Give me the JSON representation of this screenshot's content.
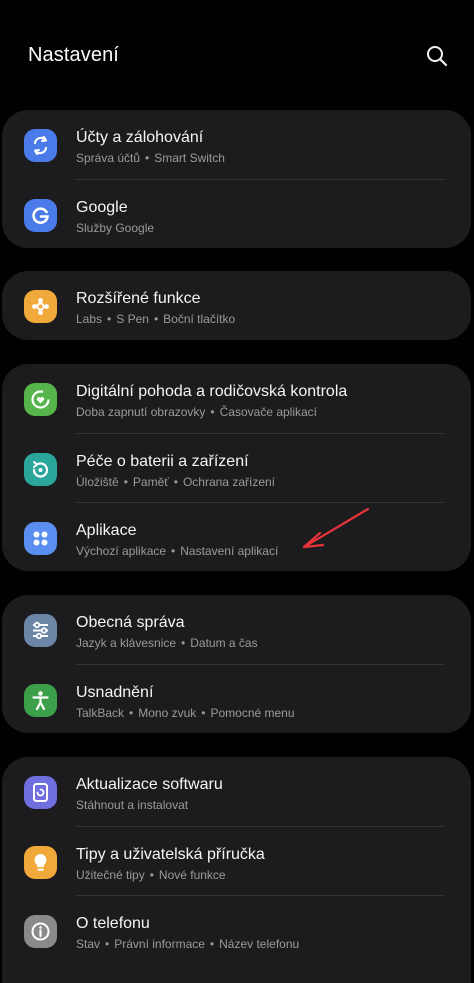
{
  "header": {
    "title": "Nastavení"
  },
  "cards": [
    {
      "rows": [
        {
          "label": "Účty a zálohování",
          "sub": [
            "Správa účtů",
            "Smart Switch"
          ],
          "icon": "sync-icon",
          "color": "#4b7bea"
        },
        {
          "label": "Google",
          "sub": [
            "Služby Google"
          ],
          "icon": "google-icon",
          "color": "#4b7bea"
        }
      ]
    },
    {
      "rows": [
        {
          "label": "Rozšířené funkce",
          "sub": [
            "Labs",
            "S Pen",
            "Boční tlačítko"
          ],
          "icon": "puzzle-icon",
          "color": "#f0a93a"
        }
      ]
    },
    {
      "rows": [
        {
          "label": "Digitální pohoda a rodičovská kontrola",
          "sub": [
            "Doba zapnutí obrazovky",
            "Časovače aplikací"
          ],
          "icon": "wellbeing-icon",
          "color": "#56b54a"
        },
        {
          "label": "Péče o baterii a zařízení",
          "sub": [
            "Úložiště",
            "Paměť",
            "Ochrana zařízení"
          ],
          "icon": "device-care-icon",
          "color": "#2aa69a"
        },
        {
          "label": "Aplikace",
          "sub": [
            "Výchozí aplikace",
            "Nastavení aplikací"
          ],
          "icon": "apps-icon",
          "color": "#5a8ef0"
        }
      ]
    },
    {
      "rows": [
        {
          "label": "Obecná správa",
          "sub": [
            "Jazyk a klávesnice",
            "Datum a čas"
          ],
          "icon": "sliders-icon",
          "color": "#6b86a6"
        },
        {
          "label": "Usnadnění",
          "sub": [
            "TalkBack",
            "Mono zvuk",
            "Pomocné menu"
          ],
          "icon": "accessibility-icon",
          "color": "#3c9f4a"
        }
      ]
    },
    {
      "rows": [
        {
          "label": "Aktualizace softwaru",
          "sub": [
            "Stáhnout a instalovat"
          ],
          "icon": "update-icon",
          "color": "#6f6fe0"
        },
        {
          "label": "Tipy a uživatelská příručka",
          "sub": [
            "Užitečné tipy",
            "Nové funkce"
          ],
          "icon": "lightbulb-icon",
          "color": "#f0a93a"
        },
        {
          "label": "O telefonu",
          "sub": [
            "Stav",
            "Právní informace",
            "Název telefonu"
          ],
          "icon": "info-icon",
          "color": "#8a8a8a"
        }
      ]
    }
  ]
}
